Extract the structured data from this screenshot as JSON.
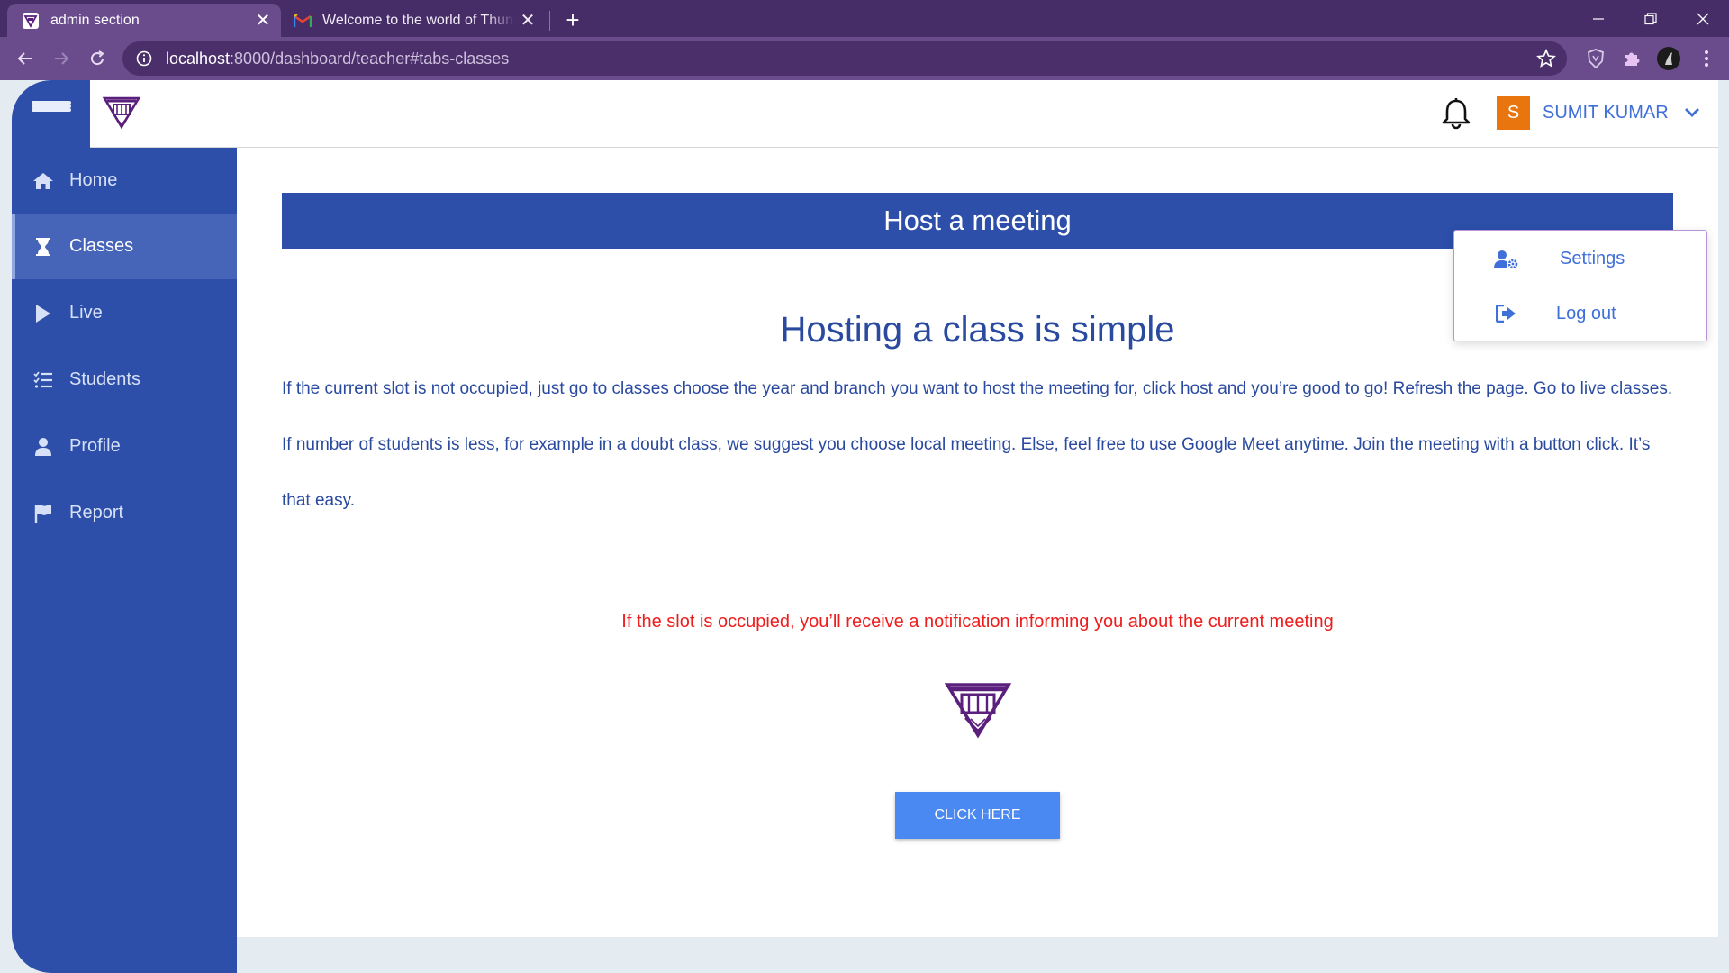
{
  "browser": {
    "tabs": [
      {
        "title": "admin section",
        "favicon": "site-logo-icon",
        "active": true
      },
      {
        "title": "Welcome to the world of Thunde",
        "favicon": "gmail-icon",
        "active": false
      }
    ],
    "url_host": "localhost",
    "url_rest": ":8000/dashboard/teacher#tabs-classes"
  },
  "topbar": {
    "avatar_initial": "S",
    "user_name": "SUMIT KUMAR"
  },
  "user_menu": {
    "items": [
      {
        "label": "Settings",
        "icon": "user-gear-icon"
      },
      {
        "label": "Log out",
        "icon": "logout-icon"
      }
    ]
  },
  "sidebar": {
    "items": [
      {
        "label": "Home",
        "icon": "home-icon"
      },
      {
        "label": "Classes",
        "icon": "hourglass-icon",
        "active": true
      },
      {
        "label": "Live",
        "icon": "play-icon"
      },
      {
        "label": "Students",
        "icon": "list-check-icon"
      },
      {
        "label": "Profile",
        "icon": "user-icon"
      },
      {
        "label": "Report",
        "icon": "flag-icon"
      }
    ]
  },
  "main": {
    "banner": "Host a meeting",
    "heading": "Hosting a class is simple",
    "paragraph": "If the current slot is not occupied, just go to classes choose the year and branch you want to host the meeting for, click host and you’re good to go! Refresh the page. Go to live classes. If number of students is less, for example in a doubt class, we suggest you choose local meeting. Else, feel free to use Google Meet anytime. Join the meeting with a button click. It’s that easy.",
    "warning": "If the slot is occupied, you’ll receive a notification informing you about the current meeting",
    "button_label": "CLICK HERE"
  },
  "colors": {
    "primary": "#2d4faa",
    "sidebar_active": "#4665b9",
    "button": "#4a88f2",
    "warning": "#ef1c1c",
    "avatar": "#e8750e",
    "browser_frame": "#472d67",
    "logo": "#5b1f7e"
  }
}
